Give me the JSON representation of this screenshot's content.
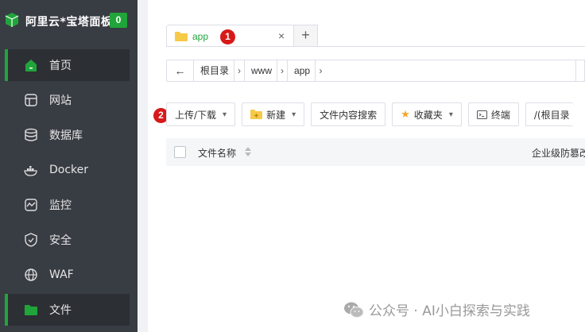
{
  "brand": {
    "title": "阿里云*宝塔面板",
    "badge": "0"
  },
  "sidebar": {
    "items": [
      {
        "label": "首页",
        "icon": "home-icon",
        "active": true
      },
      {
        "label": "网站",
        "icon": "globe-window-icon",
        "active": false
      },
      {
        "label": "数据库",
        "icon": "database-icon",
        "active": false
      },
      {
        "label": "Docker",
        "icon": "docker-icon",
        "active": false
      },
      {
        "label": "监控",
        "icon": "monitor-icon",
        "active": false
      },
      {
        "label": "安全",
        "icon": "shield-icon",
        "active": false
      },
      {
        "label": "WAF",
        "icon": "waf-icon",
        "active": false
      },
      {
        "label": "文件",
        "icon": "folder-icon",
        "active": true
      }
    ]
  },
  "tabs": [
    {
      "label": "app",
      "close": "×"
    }
  ],
  "tab_add": "+",
  "markers": {
    "one": "1",
    "two": "2"
  },
  "breadcrumb": {
    "back": "←",
    "items": [
      "根目录",
      "www",
      "app"
    ],
    "sep": "›"
  },
  "toolbar": {
    "upload": "上传/下载",
    "new": "新建",
    "search": "文件内容搜索",
    "favorites": "收藏夹",
    "terminal": "终端",
    "root": "/(根目录"
  },
  "table": {
    "col_name": "文件名称",
    "col_protect": "企业级防篡改"
  },
  "watermark": "公众号 · AI小白探索与实践",
  "colors": {
    "accent": "#20a53a",
    "sidebar": "#383c43",
    "marker": "#d7191a"
  }
}
